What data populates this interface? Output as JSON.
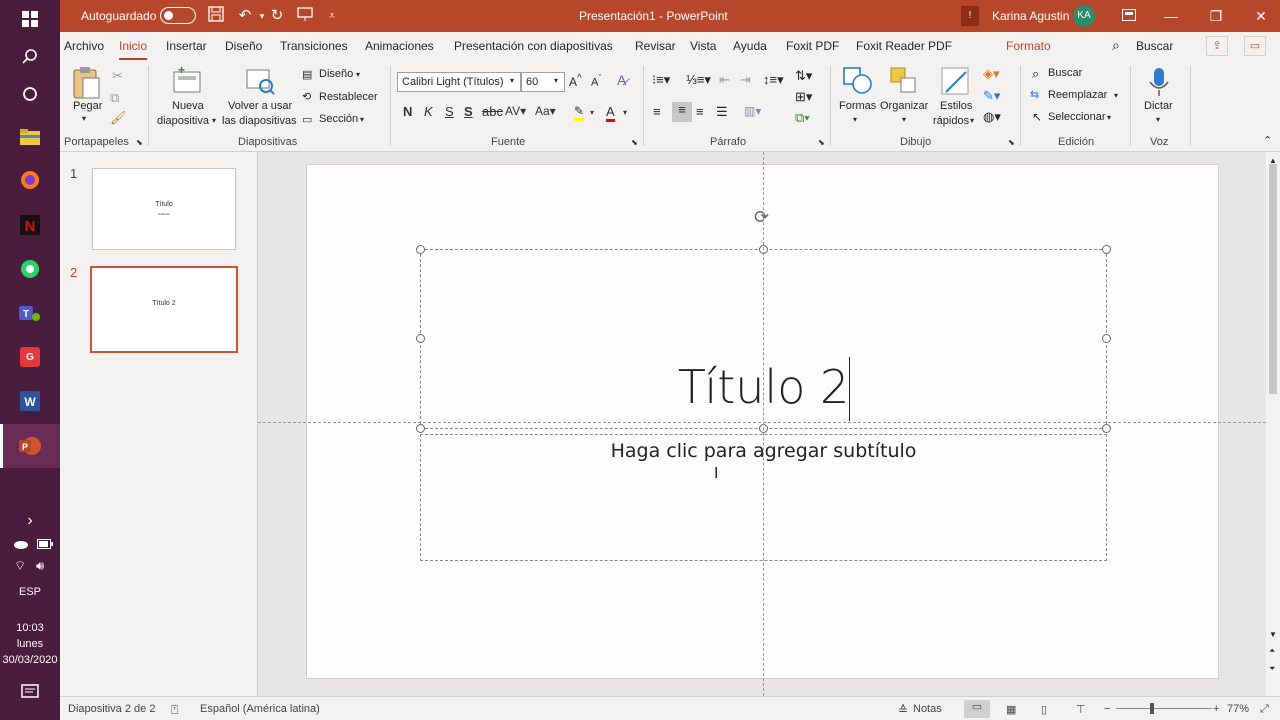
{
  "taskbar": {
    "icons": [
      "windows-start",
      "search",
      "cortana",
      "file-explorer",
      "firefox",
      "netflix",
      "whatsapp",
      "teams",
      "foxit-pdf",
      "word",
      "powerpoint"
    ],
    "tray": {
      "expand": "›",
      "lang": "ESP",
      "time": "10:03",
      "day": "lunes",
      "date": "30/03/2020"
    }
  },
  "titlebar": {
    "autosave_label": "Autoguardado",
    "doc_title": "Presentación1 - PowerPoint",
    "user_name": "Karina Agustin",
    "user_initials": "KA",
    "colors": {
      "bar": "#b7472a"
    }
  },
  "tabs": [
    "Archivo",
    "Inicio",
    "Insertar",
    "Diseño",
    "Transiciones",
    "Animaciones",
    "Presentación con diapositivas",
    "Revisar",
    "Vista",
    "Ayuda",
    "Foxit PDF",
    "Foxit Reader PDF",
    "Formato"
  ],
  "active_tab": "Inicio",
  "tell_me": "Buscar",
  "ribbon": {
    "clipboard": {
      "paste": "Pegar",
      "group": "Portapapeles"
    },
    "slides": {
      "new_slide_1": "Nueva",
      "new_slide_2": "diapositiva",
      "reuse_1": "Volver a usar",
      "reuse_2": "las diapositivas",
      "layout": "Diseño",
      "reset": "Restablecer",
      "section": "Sección",
      "group": "Diapositivas"
    },
    "font": {
      "family": "Calibri Light (Títulos)",
      "size": "60",
      "group": "Fuente"
    },
    "paragraph": {
      "group": "Párrafo"
    },
    "drawing": {
      "shapes": "Formas",
      "arrange": "Organizar",
      "quick_styles_1": "Estilos",
      "quick_styles_2": "rápidos",
      "group": "Dibujo"
    },
    "editing": {
      "find": "Buscar",
      "replace": "Reemplazar",
      "select": "Seleccionar",
      "group": "Edición"
    },
    "voice": {
      "dictate": "Dictar",
      "group": "Voz"
    }
  },
  "thumbnails": [
    {
      "number": "1",
      "title": "Título",
      "subtitle": "Subtítulo"
    },
    {
      "number": "2",
      "title": "Título 2",
      "subtitle": ""
    }
  ],
  "slide": {
    "title": "Título 2",
    "subtitle_placeholder": "Haga clic para agregar subtítulo"
  },
  "statusbar": {
    "slide_info": "Diapositiva 2 de 2",
    "language": "Español (América latina)",
    "notes": "Notas",
    "zoom": "77%"
  }
}
